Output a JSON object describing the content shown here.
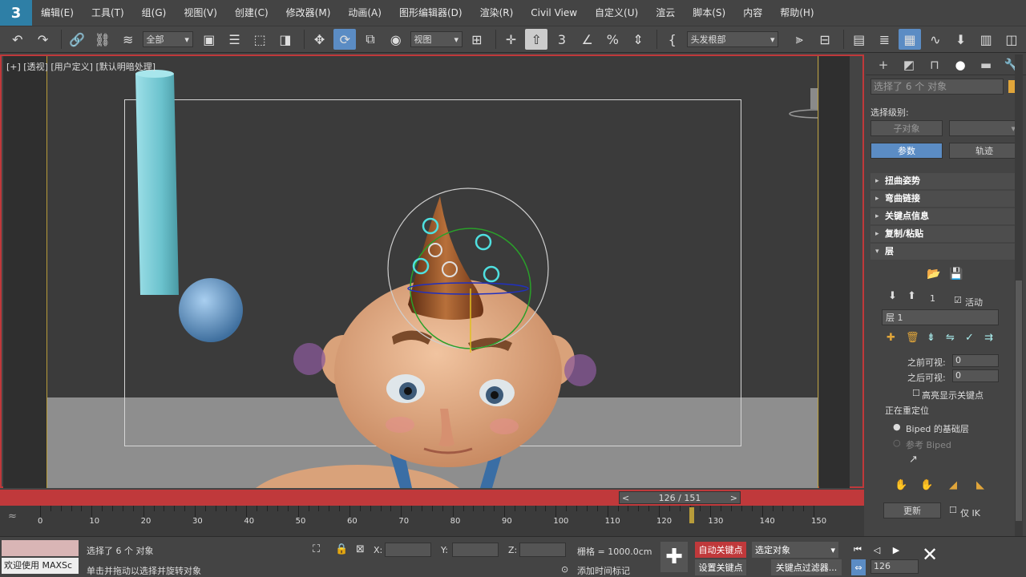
{
  "app": {
    "logo_label": "3"
  },
  "menu": {
    "items": [
      "编辑(E)",
      "工具(T)",
      "组(G)",
      "视图(V)",
      "创建(C)",
      "修改器(M)",
      "动画(A)",
      "图形编辑器(D)",
      "渲染(R)",
      "Civil View",
      "自定义(U)",
      "渲云",
      "脚本(S)",
      "内容",
      "帮助(H)"
    ]
  },
  "toolbar": {
    "selection_filter": "全部",
    "reference_coord": "视图",
    "named_selection": "头发根部"
  },
  "viewport": {
    "label": "[+] [透视] [用户定义] [默认明暗处理]"
  },
  "timeline": {
    "frame_display": "126 / 151",
    "prev": "<",
    "next": ">",
    "ticks": [
      "0",
      "10",
      "20",
      "30",
      "40",
      "50",
      "60",
      "70",
      "80",
      "90",
      "100",
      "110",
      "120",
      "130",
      "140",
      "150"
    ]
  },
  "status": {
    "selection_msg": "选择了 6 个 对象",
    "prompt": "单击并拖动以选择并旋转对象",
    "welcome": "欢迎使用 MAXSc",
    "x_label": "X:",
    "y_label": "Y:",
    "z_label": "Z:",
    "grid": "栅格 = 1000.0cm",
    "add_time_tag": "添加时间标记",
    "auto_key": "自动关键点",
    "set_key": "设置关键点",
    "selected": "选定对象",
    "key_filters": "关键点过滤器...",
    "current_frame": "126"
  },
  "command_panel": {
    "name_field": "选择了 6 个 对象",
    "selection_level": "选择级别:",
    "sub_object": "子对象",
    "params_btn": "参数",
    "track_btn": "轨迹",
    "rollouts": [
      "扭曲姿势",
      "弯曲链接",
      "关键点信息",
      "复制/粘贴",
      "层"
    ],
    "layer_number": "1",
    "active_label": "活动",
    "layer_name": "层 1",
    "before_visible": "之前可视:",
    "after_visible": "之后可视:",
    "before_value": "0",
    "after_value": "0",
    "highlight_keys": "高亮显示关键点",
    "relocating": "正在重定位",
    "biped_base": "Biped 的基础层",
    "ref_biped": "参考 Biped",
    "update_btn": "更新",
    "ik_only": "仅 IK"
  },
  "colors": {
    "accent": "#5b8cc4",
    "timebar": "#c0393b",
    "autokey": "#c0393b"
  }
}
